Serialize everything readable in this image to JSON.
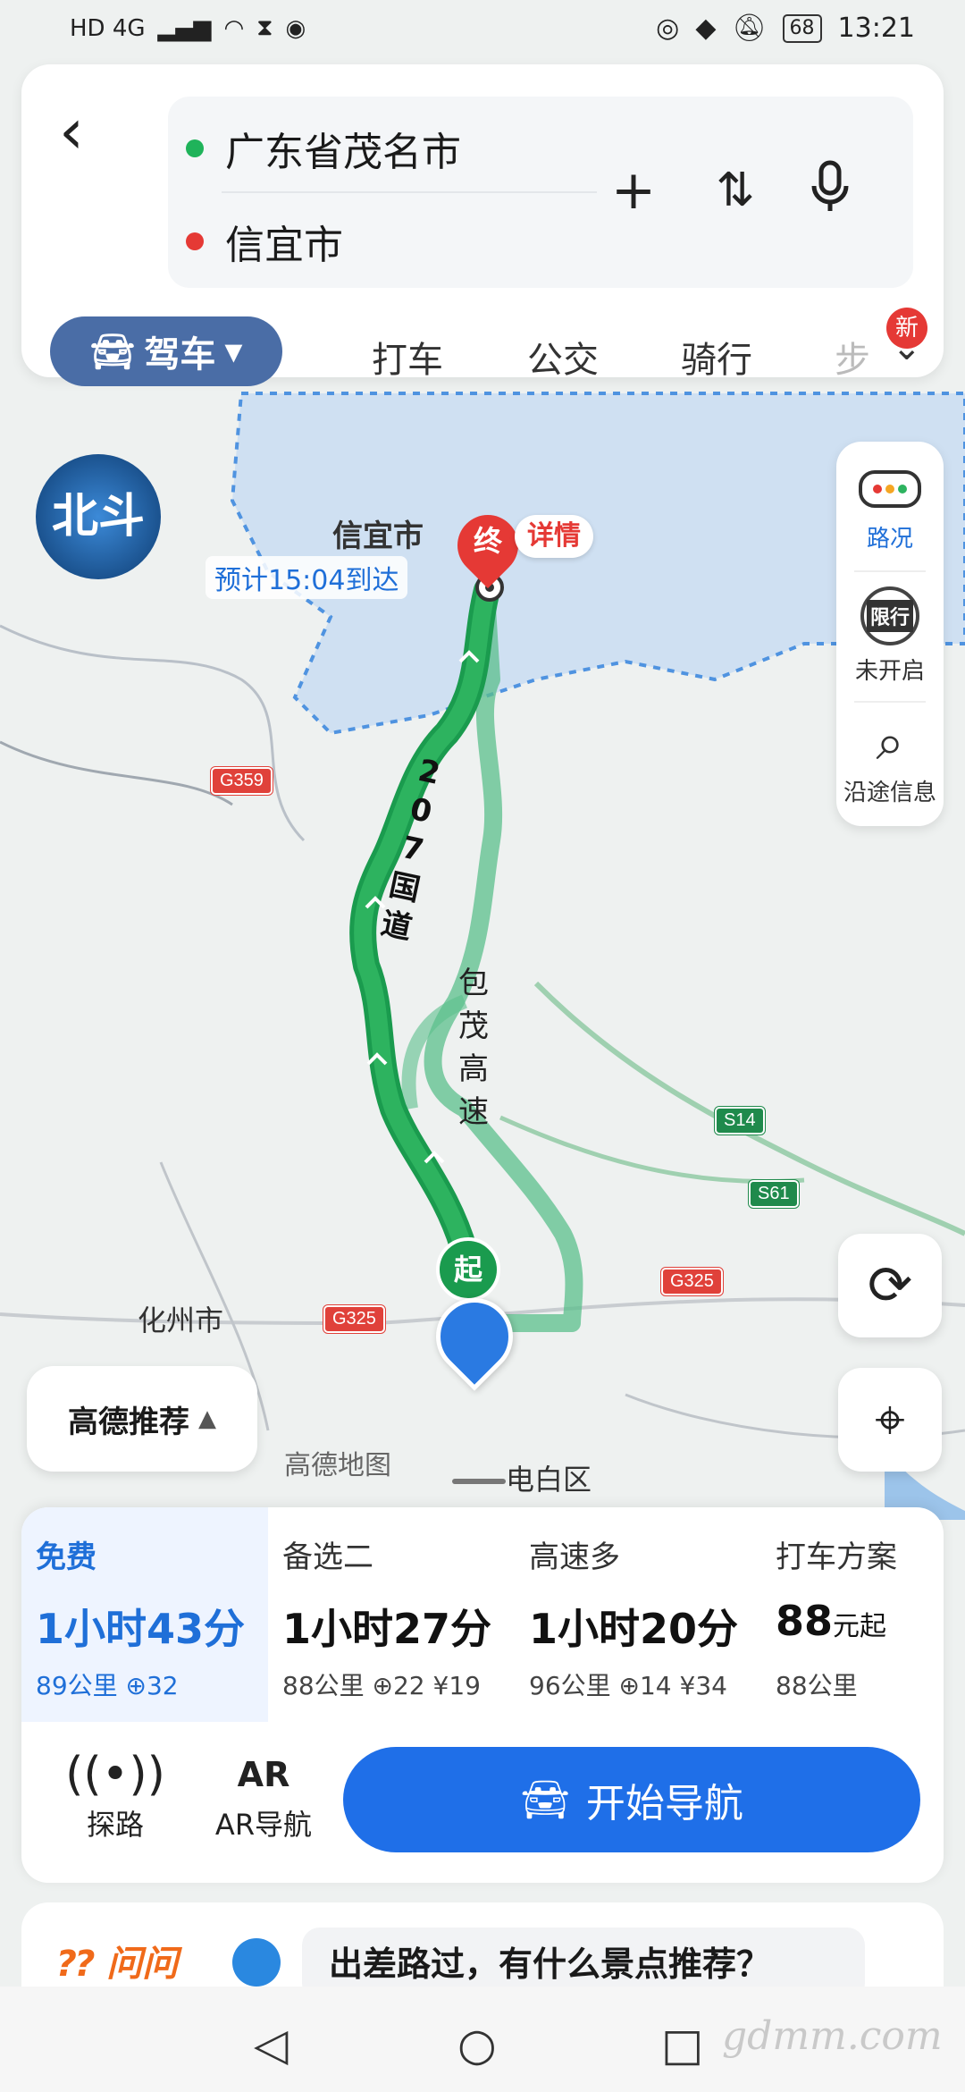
{
  "status_bar": {
    "time": "13:21",
    "battery": "68",
    "left_text": "HD 4G"
  },
  "route": {
    "from": "广东省茂名市",
    "to": "信宜市"
  },
  "modes": {
    "drive": "驾车",
    "taxi": "打车",
    "bus": "公交",
    "bike": "骑行",
    "walk": "步",
    "new_badge": "新"
  },
  "map": {
    "beidou_logo": "北斗",
    "dest_name": "信宜市",
    "end_marker": "终",
    "details": "详情",
    "eta": "预计15:04到达",
    "start_marker": "起",
    "road_207": [
      "2",
      "0",
      "7",
      "国",
      "道"
    ],
    "road_baomao": [
      "包",
      "茂",
      "高",
      "速"
    ],
    "places": {
      "huazhou": "化州市",
      "dianbai": "电白区",
      "gaode_map": "高德地图"
    },
    "shields": {
      "g359": "G359",
      "s14": "S14",
      "s61": "S61",
      "g325a": "G325",
      "g325b": "G325"
    }
  },
  "tools": {
    "traffic": "路况",
    "restrict": "限行",
    "restrict_status": "未开启",
    "along": "沿途信息"
  },
  "recommend": "高德推荐",
  "route_options": [
    {
      "label": "免费",
      "time": "1小时43分",
      "sub": "89公里 ⊕32"
    },
    {
      "label": "备选二",
      "time": "1小时27分",
      "sub": "88公里 ⊕22 ¥19"
    },
    {
      "label": "高速多",
      "time": "1小时20分",
      "sub": "96公里 ⊕14 ¥34"
    },
    {
      "label": "打车方案",
      "time_value": "88",
      "time_unit": "元起",
      "sub": "88公里"
    }
  ],
  "actions": {
    "explore": "探路",
    "ar": "AR导航",
    "ar_icon": "AR"
  },
  "start_nav": "开始导航",
  "ask": {
    "label": "问问",
    "prompt": "出差路过，有什么景点推荐？"
  },
  "watermark": "gdmm.com"
}
